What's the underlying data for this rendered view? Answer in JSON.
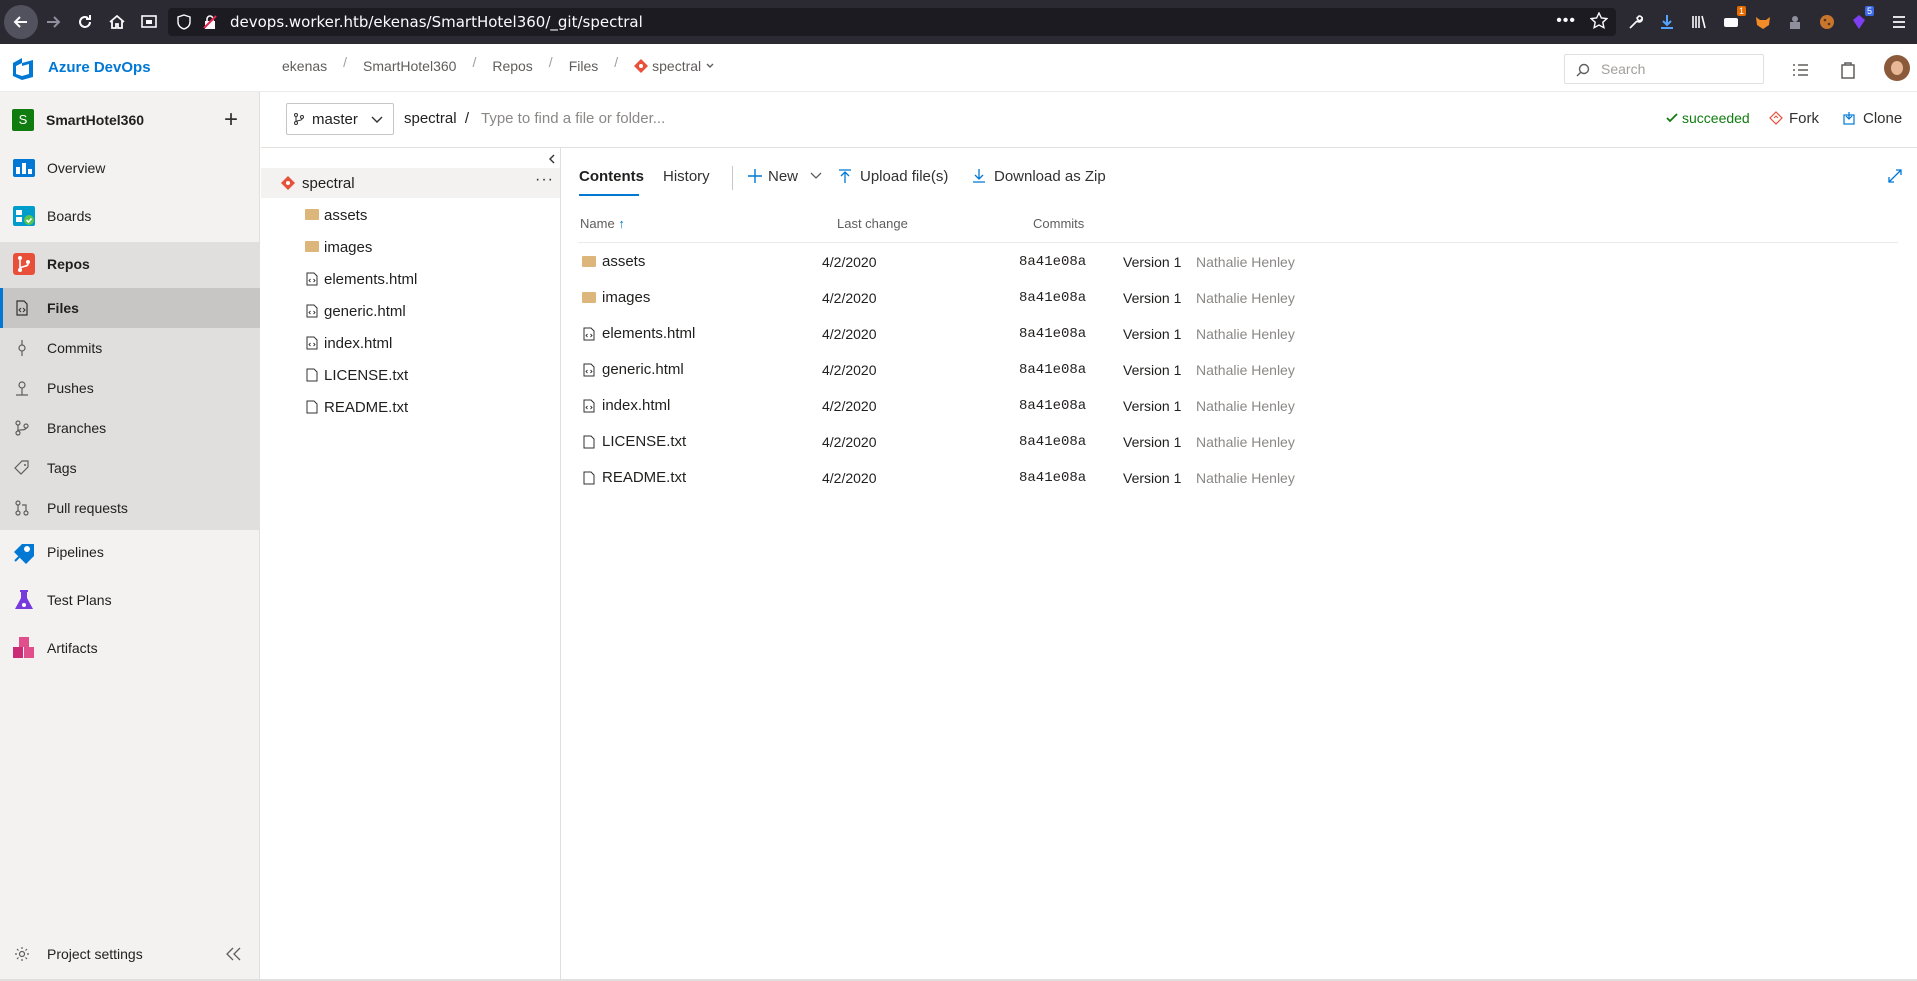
{
  "browser": {
    "url": "devops.worker.htb/ekenas/SmartHotel360/_git/spectral",
    "badge_count_1": "1",
    "badge_count_2": "5"
  },
  "header": {
    "brand": "Azure DevOps",
    "breadcrumb": [
      "ekenas",
      "SmartHotel360",
      "Repos",
      "Files",
      "spectral"
    ],
    "search_placeholder": "Search"
  },
  "sidebar": {
    "project_initial": "S",
    "project_name": "SmartHotel360",
    "items": {
      "overview": "Overview",
      "boards": "Boards",
      "repos": "Repos",
      "files": "Files",
      "commits": "Commits",
      "pushes": "Pushes",
      "branches": "Branches",
      "tags": "Tags",
      "pull_requests": "Pull requests",
      "pipelines": "Pipelines",
      "test_plans": "Test Plans",
      "artifacts": "Artifacts"
    },
    "project_settings": "Project settings"
  },
  "subbar": {
    "branch": "master",
    "path_root": "spectral",
    "path_sep": "/",
    "path_placeholder": "Type to find a file or folder...",
    "status": "succeeded",
    "fork": "Fork",
    "clone": "Clone"
  },
  "tree": {
    "root": "spectral",
    "items": [
      "assets",
      "images",
      "elements.html",
      "generic.html",
      "index.html",
      "LICENSE.txt",
      "README.txt"
    ]
  },
  "main": {
    "tabs": [
      "Contents",
      "History"
    ],
    "toolbar": {
      "new": "New",
      "upload": "Upload file(s)",
      "download": "Download as Zip"
    },
    "columns": {
      "name": "Name",
      "last_change": "Last change",
      "commits": "Commits"
    },
    "rows": [
      {
        "name": "assets",
        "type": "folder",
        "date": "4/2/2020",
        "commit": "8a41e08a",
        "message": "Version 1",
        "author": "Nathalie Henley"
      },
      {
        "name": "images",
        "type": "folder",
        "date": "4/2/2020",
        "commit": "8a41e08a",
        "message": "Version 1",
        "author": "Nathalie Henley"
      },
      {
        "name": "elements.html",
        "type": "code",
        "date": "4/2/2020",
        "commit": "8a41e08a",
        "message": "Version 1",
        "author": "Nathalie Henley"
      },
      {
        "name": "generic.html",
        "type": "code",
        "date": "4/2/2020",
        "commit": "8a41e08a",
        "message": "Version 1",
        "author": "Nathalie Henley"
      },
      {
        "name": "index.html",
        "type": "code",
        "date": "4/2/2020",
        "commit": "8a41e08a",
        "message": "Version 1",
        "author": "Nathalie Henley"
      },
      {
        "name": "LICENSE.txt",
        "type": "file",
        "date": "4/2/2020",
        "commit": "8a41e08a",
        "message": "Version 1",
        "author": "Nathalie Henley"
      },
      {
        "name": "README.txt",
        "type": "file",
        "date": "4/2/2020",
        "commit": "8a41e08a",
        "message": "Version 1",
        "author": "Nathalie Henley"
      }
    ]
  },
  "colors": {
    "accent": "#0078d4",
    "success": "#107c10",
    "folder": "#dcb67a",
    "repo_icon": "#e8503a"
  }
}
